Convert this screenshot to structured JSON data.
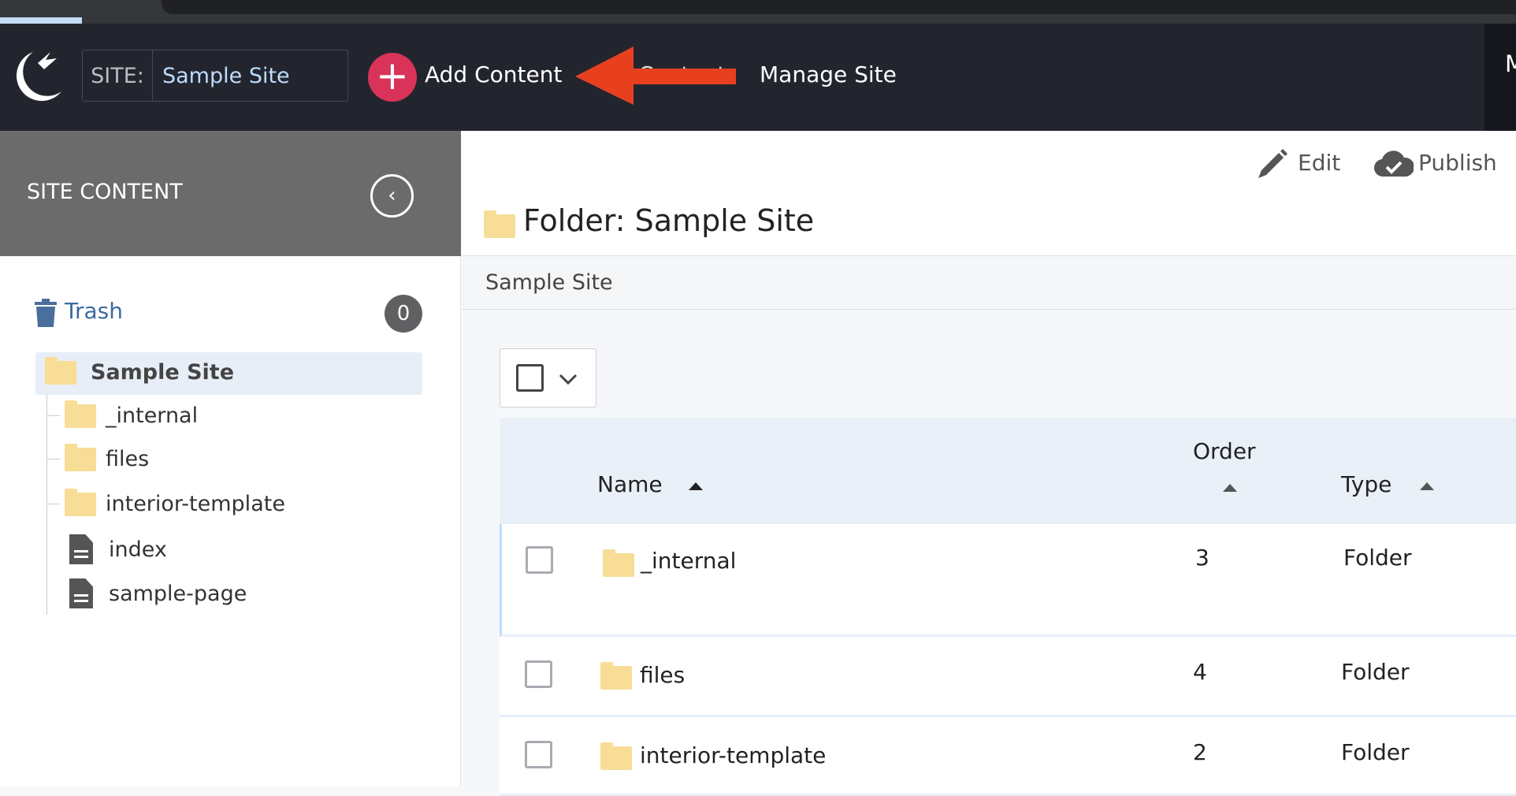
{
  "nav": {
    "site_label": "SITE:",
    "site_value": "Sample Site",
    "add_content": "Add Content",
    "content": "Content",
    "manage_site": "Manage Site",
    "right_partial": "M"
  },
  "sidebar": {
    "title": "SITE CONTENT",
    "trash_label": "Trash",
    "trash_count": "0",
    "root": "Sample Site",
    "items": [
      {
        "label": "_internal",
        "icon": "folder-icon"
      },
      {
        "label": "files",
        "icon": "folder-icon"
      },
      {
        "label": "interior-template",
        "icon": "folder-icon"
      },
      {
        "label": "index",
        "icon": "document-icon"
      },
      {
        "label": "sample-page",
        "icon": "document-icon"
      }
    ]
  },
  "main": {
    "edit": "Edit",
    "publish": "Publish",
    "title": "Folder: Sample Site",
    "breadcrumb": "Sample Site",
    "table": {
      "headers": {
        "name": "Name",
        "order": "Order",
        "type": "Type"
      },
      "rows": [
        {
          "name": "_internal",
          "order": "3",
          "type": "Folder"
        },
        {
          "name": "files",
          "order": "4",
          "type": "Folder"
        },
        {
          "name": "interior-template",
          "order": "2",
          "type": "Folder"
        }
      ]
    }
  },
  "colors": {
    "nav_bg": "#23252e",
    "add_button": "#d9335a",
    "annotation_arrow": "#e8401f",
    "folder": "#f7dd96",
    "selected": "#e8eef8"
  }
}
